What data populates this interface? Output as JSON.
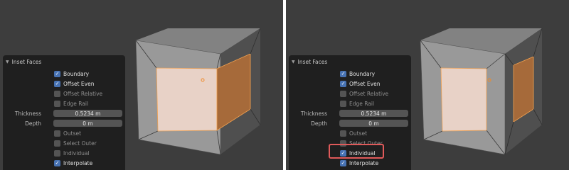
{
  "left": {
    "panel": {
      "title": "Inset Faces",
      "options_a": [
        {
          "label": "Boundary",
          "checked": true
        },
        {
          "label": "Offset Even",
          "checked": true
        },
        {
          "label": "Offset Relative",
          "checked": false
        },
        {
          "label": "Edge Rail",
          "checked": false
        }
      ],
      "thickness": {
        "label": "Thickness",
        "value": "0.5234 m"
      },
      "depth": {
        "label": "Depth",
        "value": "0 m"
      },
      "options_b": [
        {
          "label": "Outset",
          "checked": false
        },
        {
          "label": "Select Outer",
          "checked": false
        },
        {
          "label": "Individual",
          "checked": false
        },
        {
          "label": "Interpolate",
          "checked": true
        }
      ]
    }
  },
  "right": {
    "panel": {
      "title": "Inset Faces",
      "options_a": [
        {
          "label": "Boundary",
          "checked": true
        },
        {
          "label": "Offset Even",
          "checked": true
        },
        {
          "label": "Offset Relative",
          "checked": false
        },
        {
          "label": "Edge Rail",
          "checked": false
        }
      ],
      "thickness": {
        "label": "Thickness",
        "value": "0.5234 m"
      },
      "depth": {
        "label": "Depth",
        "value": "0 m"
      },
      "options_b": [
        {
          "label": "Outset",
          "checked": false
        },
        {
          "label": "Select Outer",
          "checked": false
        },
        {
          "label": "Individual",
          "checked": true
        },
        {
          "label": "Interpolate",
          "checked": true
        }
      ]
    }
  },
  "colors": {
    "viewport_bg": "#3d3d3d",
    "panel_bg": "#1f1f1f",
    "checkbox_on": "#4772b3",
    "selected_face": "#e8d2c7",
    "side_face_orange": "#a66a3a",
    "highlight_box": "#e05a5a"
  }
}
